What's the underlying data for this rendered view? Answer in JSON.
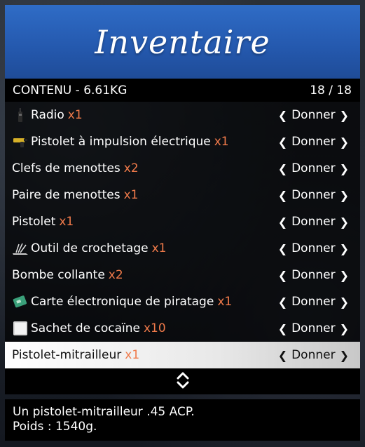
{
  "banner": {
    "title": "Inventaire"
  },
  "header": {
    "label": "CONTENU - 6.61KG",
    "count": "18 / 18"
  },
  "action_label": "Donner",
  "items": [
    {
      "name": "Radio",
      "qty": "x1",
      "icon": "radio-icon"
    },
    {
      "name": "Pistolet à impulsion électrique",
      "qty": "x1",
      "icon": "taser-icon"
    },
    {
      "name": "Clefs de menottes",
      "qty": "x2",
      "icon": ""
    },
    {
      "name": "Paire de menottes",
      "qty": "x1",
      "icon": ""
    },
    {
      "name": "Pistolet",
      "qty": "x1",
      "icon": ""
    },
    {
      "name": "Outil de crochetage",
      "qty": "x1",
      "icon": "lockpick-icon"
    },
    {
      "name": "Bombe collante",
      "qty": "x2",
      "icon": ""
    },
    {
      "name": "Carte électronique de piratage",
      "qty": "x1",
      "icon": "hacking-card-icon"
    },
    {
      "name": "Sachet de cocaïne",
      "qty": "x10",
      "icon": "bag-icon"
    },
    {
      "name": "Pistolet-mitrailleur",
      "qty": "x1",
      "icon": ""
    }
  ],
  "selected_index": 9,
  "description": {
    "line1": "Un pistolet-mitrailleur .45 ACP.",
    "line2": "Poids : 1540g."
  },
  "colors": {
    "banner": "#2458ad",
    "qty": "#f07a4a"
  }
}
